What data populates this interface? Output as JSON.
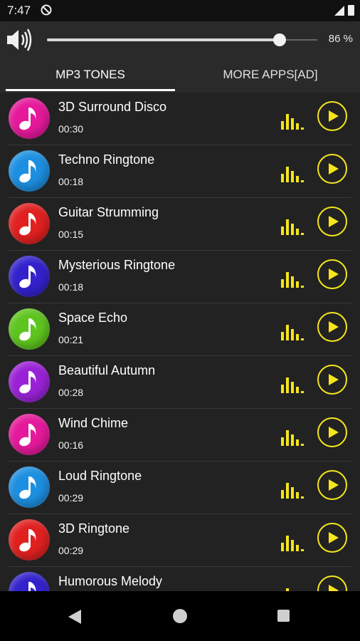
{
  "status_bar": {
    "time": "7:47",
    "icons": [
      "dnd-icon",
      "signal-icon",
      "battery-icon"
    ]
  },
  "volume": {
    "icon": "speaker-icon",
    "level_percent": 86,
    "label": "86 %"
  },
  "tabs": [
    {
      "label": "MP3 TONES",
      "selected": true
    },
    {
      "label": "MORE APPS[AD]",
      "selected": false
    }
  ],
  "colors": {
    "accent": "#f5e51c",
    "background": "#222222",
    "tabbar": "#2a2a2a"
  },
  "ringtones": [
    {
      "title": "3D Surround Disco",
      "duration": "00:30",
      "color": "#e5199b"
    },
    {
      "title": "Techno Ringtone",
      "duration": "00:18",
      "color": "#1d8fe0"
    },
    {
      "title": "Guitar Strumming",
      "duration": "00:15",
      "color": "#e12020"
    },
    {
      "title": "Mysterious Ringtone",
      "duration": "00:18",
      "color": "#3322cc"
    },
    {
      "title": "Space Echo",
      "duration": "00:21",
      "color": "#5ec41e"
    },
    {
      "title": "Beautiful Autumn",
      "duration": "00:28",
      "color": "#9a22d6"
    },
    {
      "title": "Wind Chime",
      "duration": "00:16",
      "color": "#e5199b"
    },
    {
      "title": "Loud Ringtone",
      "duration": "00:29",
      "color": "#1d8fe0"
    },
    {
      "title": "3D Ringtone",
      "duration": "00:29",
      "color": "#e12020"
    },
    {
      "title": "Humorous Melody",
      "duration": "",
      "color": "#3322cc"
    }
  ],
  "nav_bar": {
    "icons": [
      "back-icon",
      "home-icon",
      "recents-icon"
    ]
  }
}
